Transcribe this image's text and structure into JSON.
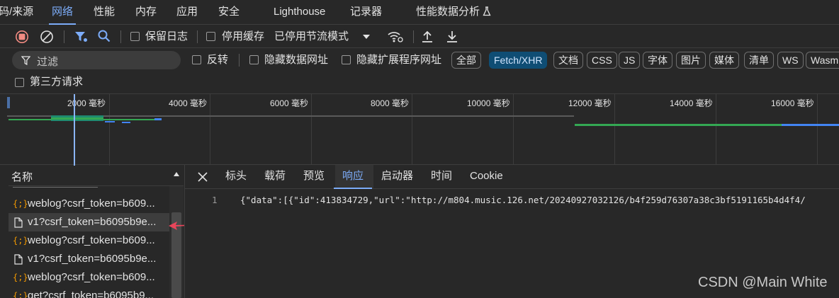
{
  "main_tabs": [
    {
      "label": "码/来源"
    },
    {
      "label": "网络",
      "active": true
    },
    {
      "label": "性能"
    },
    {
      "label": "内存"
    },
    {
      "label": "应用"
    },
    {
      "label": "安全"
    },
    {
      "label": "Lighthouse"
    },
    {
      "label": "记录器"
    },
    {
      "label": "性能数据分析"
    }
  ],
  "toolbar": {
    "record_icon": "record-stop-icon",
    "clear_icon": "clear-icon",
    "filter_icon": "filter-icon",
    "search_icon": "search-icon",
    "preserve_log": "保留日志",
    "disable_cache": "停用缓存",
    "throttling": "已停用节流模式",
    "wifi_icon": "network-conditions-icon",
    "import_icon": "upload-icon",
    "export_icon": "download-icon"
  },
  "filter_bar": {
    "filter_placeholder": "过滤",
    "invert": "反转",
    "hide_data_urls": "隐藏数据网址",
    "hide_extension_urls": "隐藏扩展程序网址",
    "type_chips": [
      "全部",
      "Fetch/XHR",
      "文档",
      "CSS",
      "JS",
      "字体",
      "图片",
      "媒体",
      "清单",
      "WS",
      "Wasm"
    ],
    "active_chip": "Fetch/XHR",
    "third_party": "第三方请求"
  },
  "timeline": {
    "ticks": [
      "2000 毫秒",
      "4000 毫秒",
      "6000 毫秒",
      "8000 毫秒",
      "10000 毫秒",
      "12000 毫秒",
      "14000 毫秒",
      "16000 毫秒"
    ]
  },
  "request_list": {
    "header": "名称",
    "rows": [
      {
        "name": "weblog?csrf_token=b609...",
        "type": "xhr",
        "selected": false
      },
      {
        "name": "v1?csrf_token=b6095b9e...",
        "type": "doc",
        "selected": true
      },
      {
        "name": "weblog?csrf_token=b609...",
        "type": "xhr",
        "selected": false
      },
      {
        "name": "v1?csrf_token=b6095b9e...",
        "type": "doc",
        "selected": false
      },
      {
        "name": "weblog?csrf_token=b609...",
        "type": "xhr",
        "selected": false
      },
      {
        "name": "get?csrf_token=b6095b9...",
        "type": "xhr",
        "selected": false
      }
    ]
  },
  "detail": {
    "tabs": [
      "标头",
      "载荷",
      "预览",
      "响应",
      "启动器",
      "时间",
      "Cookie"
    ],
    "active_tab": "响应",
    "line_number": "1",
    "response_text": "{\"data\":[{\"id\":413834729,\"url\":\"http://m804.music.126.net/20240927032126/b4f259d76307a38c3bf5191165b4d4f4/"
  },
  "watermark": "CSDN @Main White",
  "colors": {
    "accent": "#7cacf8",
    "chip_active": "#0f4d74",
    "record_red": "#f28b82",
    "waterfall_green": "#34a853",
    "waterfall_blue": "#4285f4",
    "arrow_red": "#e8455a"
  }
}
